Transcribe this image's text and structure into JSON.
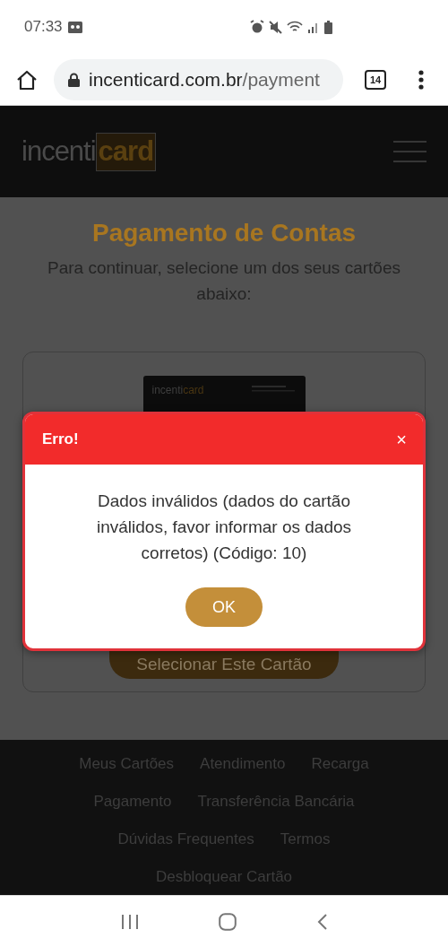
{
  "status_bar": {
    "time": "07:33"
  },
  "browser": {
    "url_host": "incenticard.com.br",
    "url_path": "/payment",
    "tab_count": "14"
  },
  "header": {
    "logo": {
      "prefix": "incenti",
      "suffix": "card"
    }
  },
  "page": {
    "title": "Pagamento de Contas",
    "subtitle": "Para continuar, selecione um dos seus cartões abaixo:",
    "card": {
      "logo": {
        "prefix": "incenti",
        "suffix": "card"
      },
      "button": "Selecionar Este Cartão"
    }
  },
  "dialog": {
    "title": "Erro!",
    "close": "×",
    "message": "Dados inválidos (dados do cartão inválidos, favor informar os dados corretos) (Código: 10)",
    "button": "OK"
  },
  "footer": {
    "links": [
      "Meus Cartões",
      "Atendimento",
      "Recarga",
      "Pagamento",
      "Transferência Bancária",
      "Dúvidas Frequentes",
      "Termos",
      "Desbloquear Cartão"
    ]
  }
}
